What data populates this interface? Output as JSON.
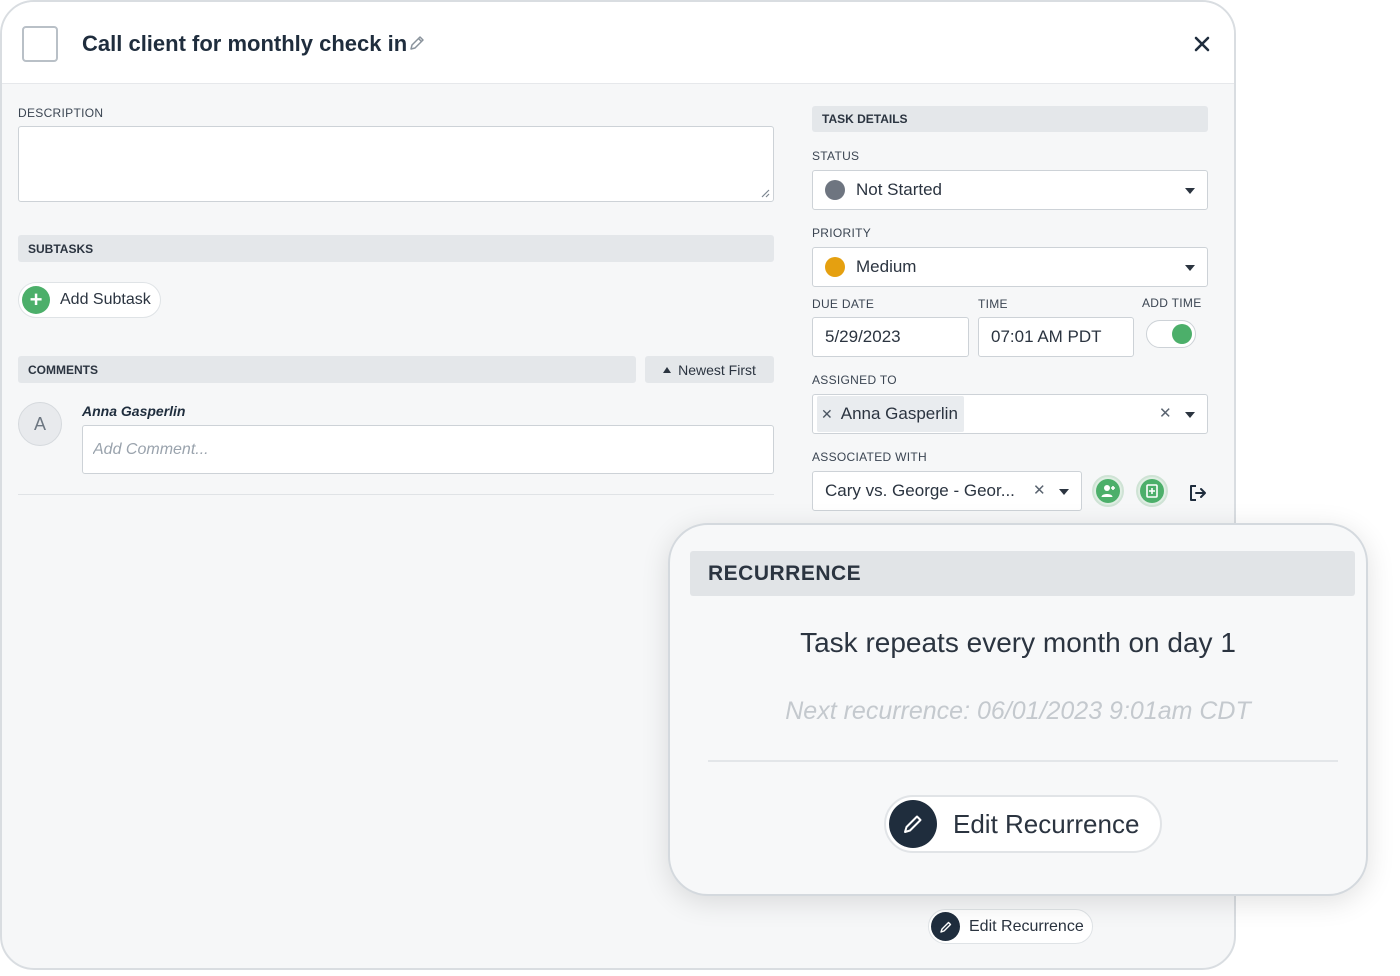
{
  "header": {
    "title": "Call client for monthly check in"
  },
  "left": {
    "description_label": "DESCRIPTION",
    "subtasks_label": "SUBTASKS",
    "add_subtask_label": "Add Subtask",
    "comments_label": "COMMENTS",
    "sort_label": "Newest First",
    "avatar_initial": "A",
    "comment_author": "Anna Gasperlin",
    "comment_placeholder": "Add Comment..."
  },
  "details": {
    "section_label": "TASK DETAILS",
    "status_label": "STATUS",
    "status_value": "Not Started",
    "status_color": "#6e7580",
    "priority_label": "PRIORITY",
    "priority_value": "Medium",
    "priority_color": "#e5a010",
    "due_date_label": "DUE DATE",
    "due_date_value": "5/29/2023",
    "time_label": "TIME",
    "time_value": "07:01 AM PDT",
    "add_time_label": "ADD TIME",
    "add_time_enabled": true,
    "assigned_label": "ASSIGNED TO",
    "assigned_chip": "Anna Gasperlin",
    "associated_label": "ASSOCIATED WITH",
    "associated_value": "Cary vs. George - Geor...",
    "edit_recurrence_label": "Edit Recurrence"
  },
  "recurrence": {
    "title": "RECURRENCE",
    "summary": "Task repeats every month on day 1",
    "next": "Next recurrence: 06/01/2023 9:01am CDT",
    "edit_label": "Edit Recurrence"
  },
  "colors": {
    "accent_green": "#4caf6a",
    "dark_navy": "#1f2d3d"
  }
}
